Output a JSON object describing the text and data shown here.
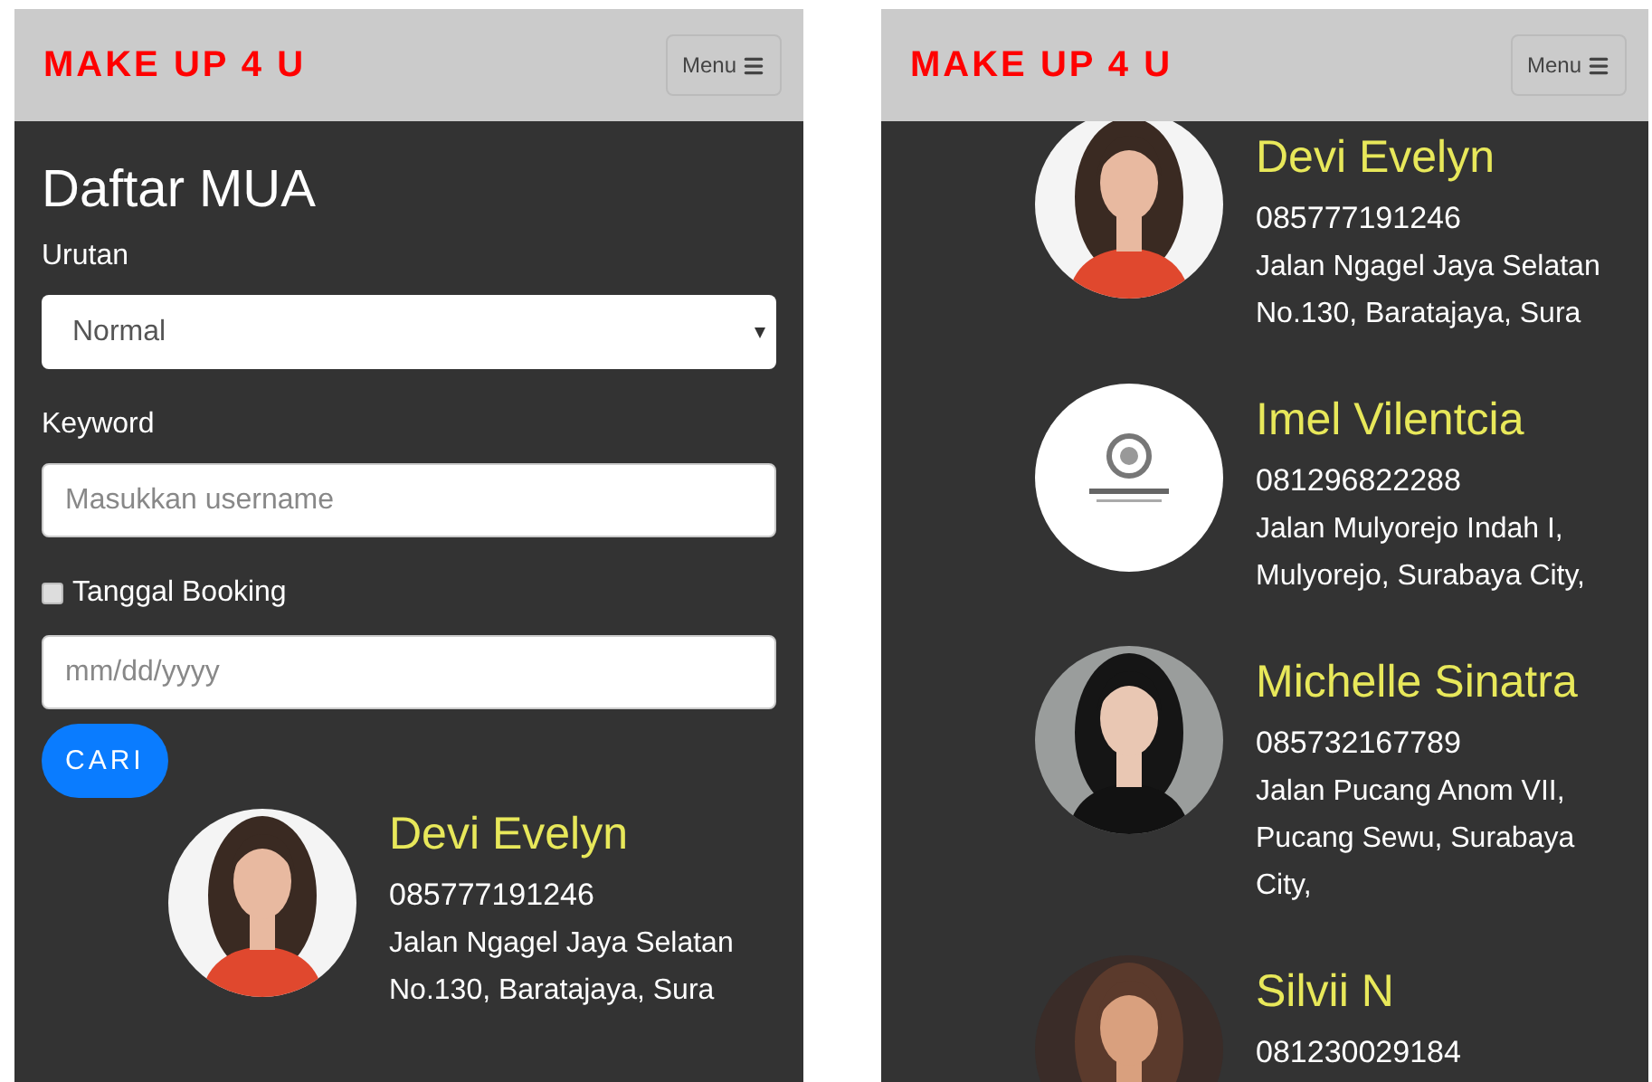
{
  "left_screen": {
    "header": {
      "brand": "MAKE UP 4 U",
      "menu_button": "Menu"
    },
    "title": "Daftar MUA",
    "form": {
      "sort_label": "Urutan",
      "sort_value": "Normal",
      "keyword_label": "Keyword",
      "keyword_placeholder": "Masukkan username",
      "date_checkbox": {
        "label": "Tanggal Booking",
        "checked": false
      },
      "date_placeholder": "mm/dd/yyyy",
      "search_button": "CARI"
    },
    "mua_list": [
      {
        "name": "Devi Evelyn",
        "phone": "085777191246",
        "address_lines": [
          "Jalan Ngagel Jaya Selatan",
          "No.130, Baratajaya, Sura"
        ]
      }
    ]
  },
  "right_screen": {
    "header": {
      "brand": "MAKE UP 4 U",
      "menu_button": "Menu"
    },
    "mua_list": [
      {
        "name": "Devi Evelyn",
        "phone": "085777191246",
        "address_lines": [
          "Jalan Ngagel Jaya Selatan",
          "No.130, Baratajaya, Sura"
        ]
      },
      {
        "name": "Imel Vilentcia",
        "phone": "081296822288",
        "address_lines": [
          "Jalan Mulyorejo Indah I,",
          "Mulyorejo, Surabaya City,"
        ]
      },
      {
        "name": "Michelle Sinatra",
        "phone": "085732167789",
        "address_lines": [
          "Jalan Pucang Anom VII,",
          "Pucang Sewu, Surabaya",
          "City,"
        ]
      },
      {
        "name": "Silvii N",
        "phone": "081230029184"
      }
    ]
  }
}
